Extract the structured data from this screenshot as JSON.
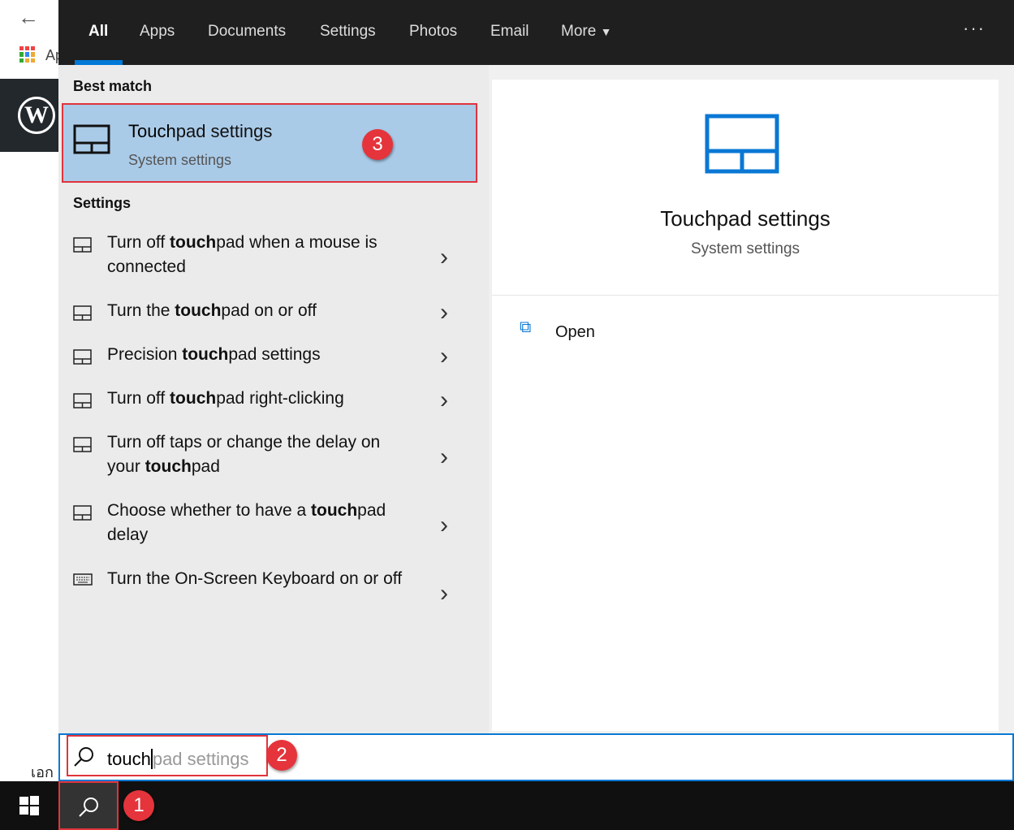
{
  "background": {
    "back_icon": "arrow-left-icon",
    "apps_label": "Ap",
    "footer_text": "เอก"
  },
  "tabs": [
    {
      "label": "All",
      "active": true
    },
    {
      "label": "Apps"
    },
    {
      "label": "Documents"
    },
    {
      "label": "Settings"
    },
    {
      "label": "Photos"
    },
    {
      "label": "Email"
    },
    {
      "label": "More"
    }
  ],
  "more_icon": "ellipsis-icon",
  "best_match": {
    "heading": "Best match",
    "title_bold": "Touch",
    "title_rest": "pad settings",
    "subtitle": "System settings",
    "badge": "3"
  },
  "settings": {
    "heading": "Settings",
    "items": [
      {
        "pre": "Turn off ",
        "bold": "touch",
        "post": "pad when a mouse is connected",
        "icon": "touchpad-icon"
      },
      {
        "pre": "Turn the ",
        "bold": "touch",
        "post": "pad on or off",
        "icon": "touchpad-icon"
      },
      {
        "pre": "Precision ",
        "bold": "touch",
        "post": "pad settings",
        "icon": "touchpad-icon"
      },
      {
        "pre": "Turn off ",
        "bold": "touch",
        "post": "pad right-clicking",
        "icon": "touchpad-icon"
      },
      {
        "pre": "Turn off taps or change the delay on your ",
        "bold": "touch",
        "post": "pad",
        "icon": "touchpad-icon"
      },
      {
        "pre": "Choose whether to have a ",
        "bold": "touch",
        "post": "pad delay",
        "icon": "touchpad-icon"
      },
      {
        "pre": "Turn the On-Screen Keyboard on or off",
        "bold": "",
        "post": "",
        "icon": "keyboard-icon"
      }
    ]
  },
  "preview": {
    "title": "Touchpad settings",
    "subtitle": "System settings",
    "open_label": "Open"
  },
  "search": {
    "typed": "touch",
    "suggestion": "pad settings",
    "badge": "2"
  },
  "taskbar": {
    "search_badge": "1"
  },
  "colors": {
    "accent": "#0078d7",
    "highlight": "#aacbe8",
    "annotation": "#e5343b"
  }
}
